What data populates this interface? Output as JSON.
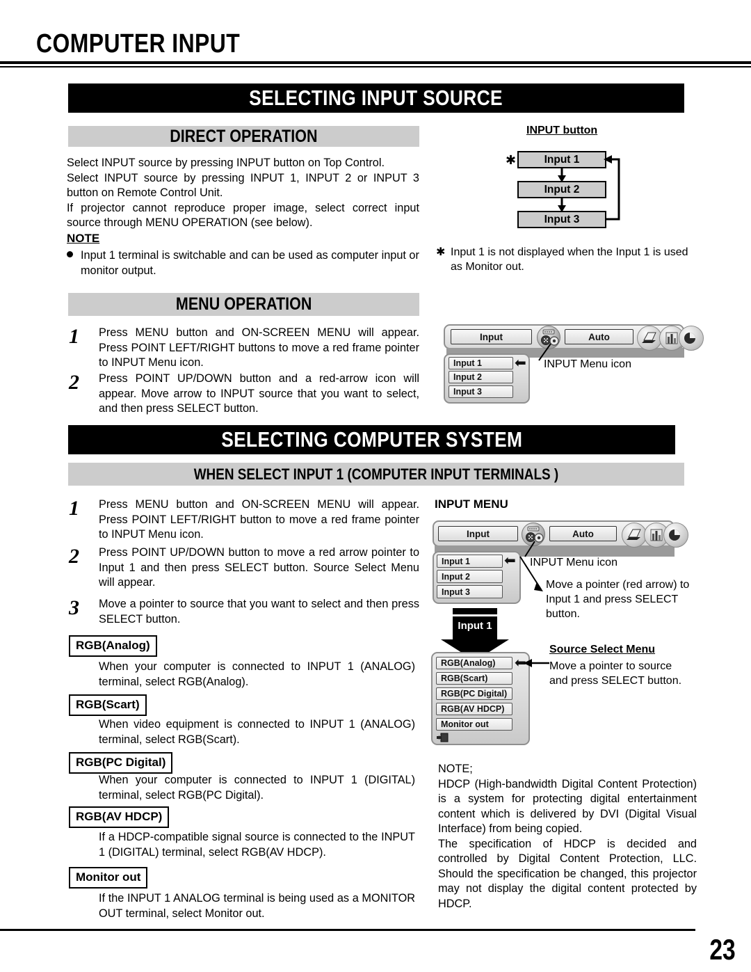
{
  "page": {
    "title": "COMPUTER INPUT",
    "number": "23"
  },
  "section_input_source": {
    "banner": "SELECTING INPUT SOURCE",
    "direct_operation": {
      "heading": "DIRECT OPERATION",
      "paragraph1": "Select INPUT source by pressing INPUT button on Top Control.",
      "paragraph2": "Select INPUT source by pressing INPUT 1, INPUT 2 or INPUT 3 button on Remote Control Unit.",
      "paragraph3": "If projector cannot reproduce proper image, select correct input source through MENU OPERATION (see below).",
      "note_heading": "NOTE",
      "note_text": "Input 1 terminal is switchable and can be used as computer input or monitor output."
    },
    "input_button_diagram": {
      "label": "INPUT button",
      "asterisk": "✱",
      "boxes": [
        "Input 1",
        "Input 2",
        "Input 3"
      ],
      "footnote_marker": "✱",
      "footnote": "Input 1 is not displayed when the Input 1 is used as Monitor out."
    },
    "menu_operation": {
      "heading": "MENU OPERATION",
      "steps": [
        {
          "number": "1",
          "text": "Press MENU button and ON-SCREEN MENU will appear.  Press POINT LEFT/RIGHT buttons to move a red frame pointer to INPUT Menu icon."
        },
        {
          "number": "2",
          "text": "Press POINT UP/DOWN button and a red-arrow icon will appear.  Move arrow to INPUT source that you want to select, and then press SELECT button."
        }
      ]
    },
    "osd_menu_1": {
      "input_button": "Input",
      "auto_button": "Auto",
      "items": [
        "Input 1",
        "Input 2",
        "Input 3"
      ],
      "icon_caption": "INPUT Menu icon",
      "icons": [
        "computer-icon",
        "bar-icon",
        "pie-icon"
      ]
    }
  },
  "section_computer_system": {
    "banner": "SELECTING COMPUTER SYSTEM",
    "subheading": "WHEN SELECT  INPUT 1 (COMPUTER INPUT TERMINALS )",
    "steps": [
      {
        "number": "1",
        "text": "Press MENU button and ON-SCREEN MENU will appear.  Press POINT LEFT/RIGHT button to move a red frame pointer to INPUT Menu icon."
      },
      {
        "number": "2",
        "text": "Press POINT UP/DOWN button to move a red arrow pointer to Input 1 and then press SELECT button.  Source Select Menu will appear."
      },
      {
        "number": "3",
        "text": "Move a pointer to source that you want to select and then press SELECT button."
      }
    ],
    "options": [
      {
        "label": "RGB(Analog)",
        "description": "When your computer is connected to INPUT 1 (ANALOG) terminal, select RGB(Analog)."
      },
      {
        "label": "RGB(Scart)",
        "description": "When video equipment is connected to INPUT 1 (ANALOG) terminal, select RGB(Scart)."
      },
      {
        "label": "RGB(PC Digital)",
        "description": "When your computer is connected to INPUT 1 (DIGITAL) terminal, select RGB(PC Digital)."
      },
      {
        "label": "RGB(AV HDCP)",
        "description": "If a HDCP-compatible signal source is connected to the INPUT 1 (DIGITAL) terminal, select RGB(AV HDCP)."
      },
      {
        "label": "Monitor out",
        "description": "If the INPUT 1 ANALOG terminal is being used as a MONITOR OUT terminal, select Monitor out."
      }
    ],
    "input_menu_graphic": {
      "title": "INPUT MENU",
      "input_button": "Input",
      "auto_button": "Auto",
      "items": [
        "Input 1",
        "Input 2",
        "Input 3"
      ],
      "icon_caption": "INPUT Menu icon",
      "pointer_caption": "Move a pointer (red arrow) to Input 1 and press SELECT button.",
      "arrow_label": "Input 1"
    },
    "source_select_menu": {
      "title": "Source Select Menu",
      "items": [
        "RGB(Analog)",
        "RGB(Scart)",
        "RGB(PC Digital)",
        "RGB(AV HDCP)",
        "Monitor out"
      ],
      "caption": "Move a pointer to source and press SELECT button."
    },
    "hdcp_note": {
      "heading": "NOTE;",
      "paragraph1": "HDCP (High-bandwidth Digital Content Protection) is a system for protecting digital entertainment content which is delivered by DVI (Digital Visual Interface) from being copied.",
      "paragraph2": "The specification of HDCP is decided and controlled by Digital Content Protection, LLC. Should the specification be changed, this projector may not display the digital content protected by HDCP."
    }
  },
  "colors": {
    "banner_black": "#000000",
    "banner_gray": "#cccccc",
    "flow_box_gray": "#cccccc",
    "text": "#000000"
  }
}
